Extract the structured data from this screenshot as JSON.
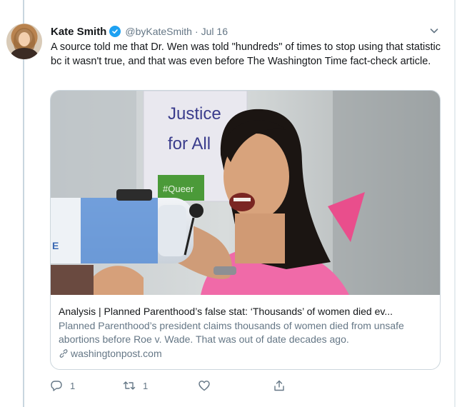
{
  "author": {
    "name": "Kate Smith",
    "handle": "@byKateSmith",
    "separator": "·",
    "date": "Jul 16"
  },
  "tweet": {
    "text": "A source told me that Dr. Wen was told \"hundreds\" of times to stop using that statistic bc it wasn't true, and that was even before The Washington Time fact-check article."
  },
  "card": {
    "title": "Analysis | Planned Parenthood’s false stat: ‘Thousands’ of women died ev...",
    "description": "Planned Parenthood’s president claims thousands of women died from unsafe abortions before Roe v. Wade. That was out of date decades ago.",
    "domain": "washingtonpost.com",
    "sign_text": {
      "line1": "Justice",
      "line2": "for All",
      "tag": "#Queer"
    }
  },
  "actions": {
    "reply_count": "1",
    "retweet_count": "1",
    "like_count": "",
    "icons": [
      "reply-icon",
      "retweet-icon",
      "like-icon",
      "share-icon"
    ]
  },
  "colors": {
    "accent": "#1da1f2",
    "secondary_text": "#657786",
    "border": "#ccd6dd"
  }
}
